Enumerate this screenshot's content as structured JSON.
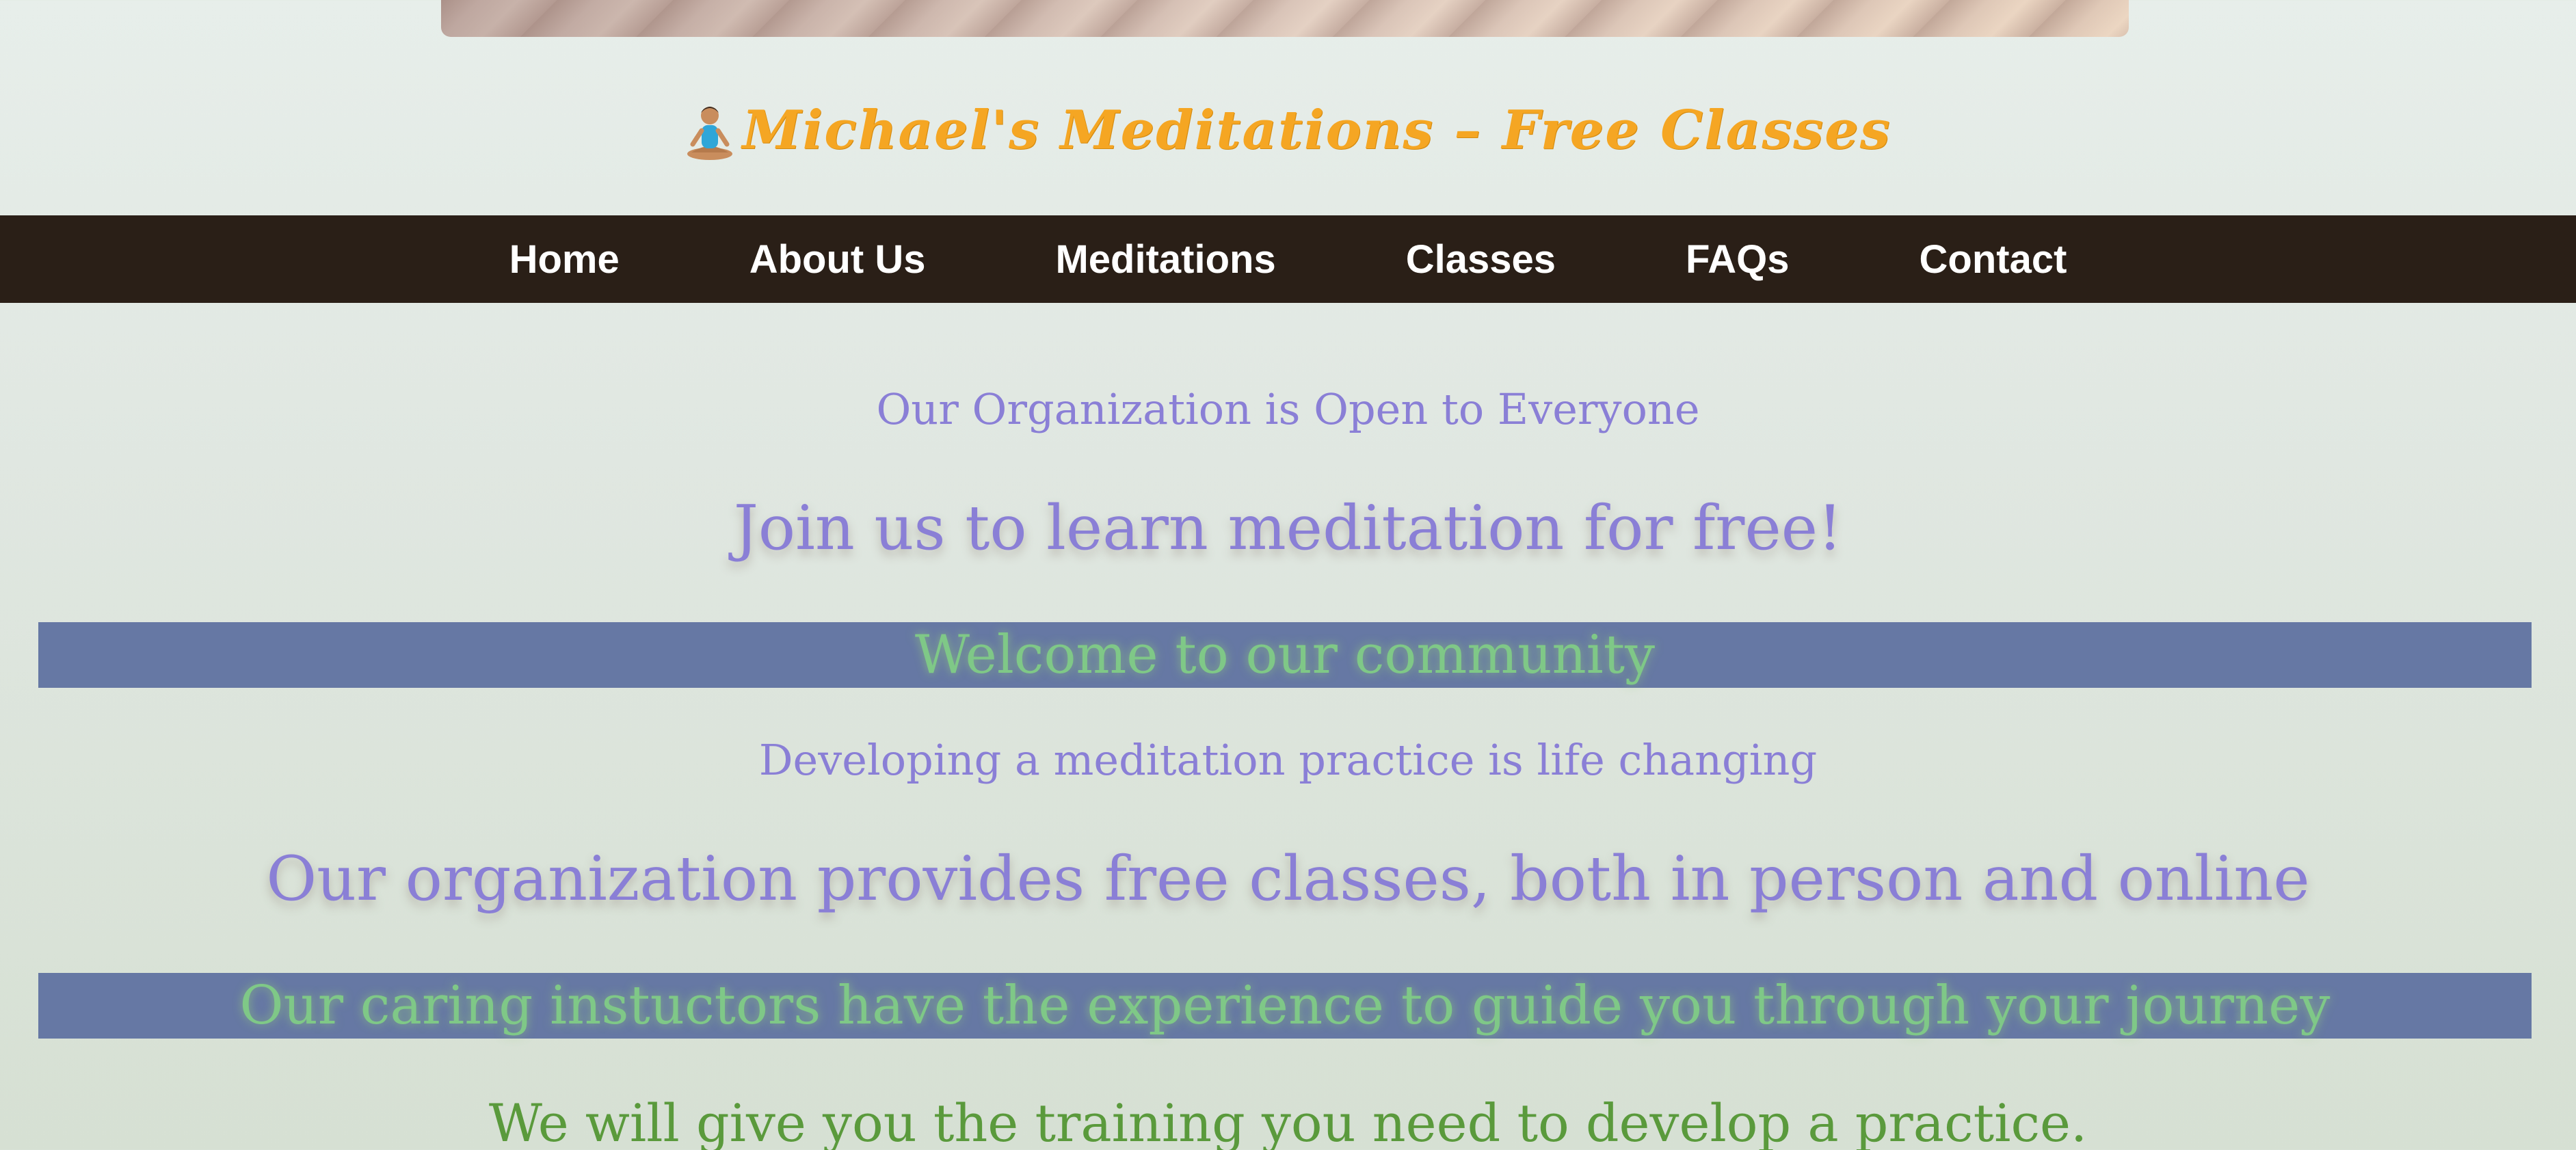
{
  "site": {
    "title": "Michael's Meditations – Free Classes",
    "title_icon": "meditating-person-icon"
  },
  "nav": {
    "items": [
      {
        "label": "Home"
      },
      {
        "label": "About Us"
      },
      {
        "label": "Meditations"
      },
      {
        "label": "Classes"
      },
      {
        "label": "FAQs"
      },
      {
        "label": "Contact"
      }
    ]
  },
  "content": {
    "line1": "Our Organization is Open to Everyone",
    "line2": "Join us to learn meditation for free!",
    "banner1": "Welcome to our community",
    "line3": "Developing a meditation practice is life changing",
    "line4": "Our organization provides free classes, both in person and online",
    "banner2": "Our caring instuctors have the experience to guide you through your journey",
    "line5": "We will give you the training you need to develop a practice."
  },
  "colors": {
    "title": "#f5a623",
    "nav_background": "#2a1f17",
    "nav_text": "#ffffff",
    "purple_text": "#8a7fd6",
    "banner_background": "#6678a4",
    "banner_text": "#7fc887",
    "green_text": "#5a9a3c"
  }
}
